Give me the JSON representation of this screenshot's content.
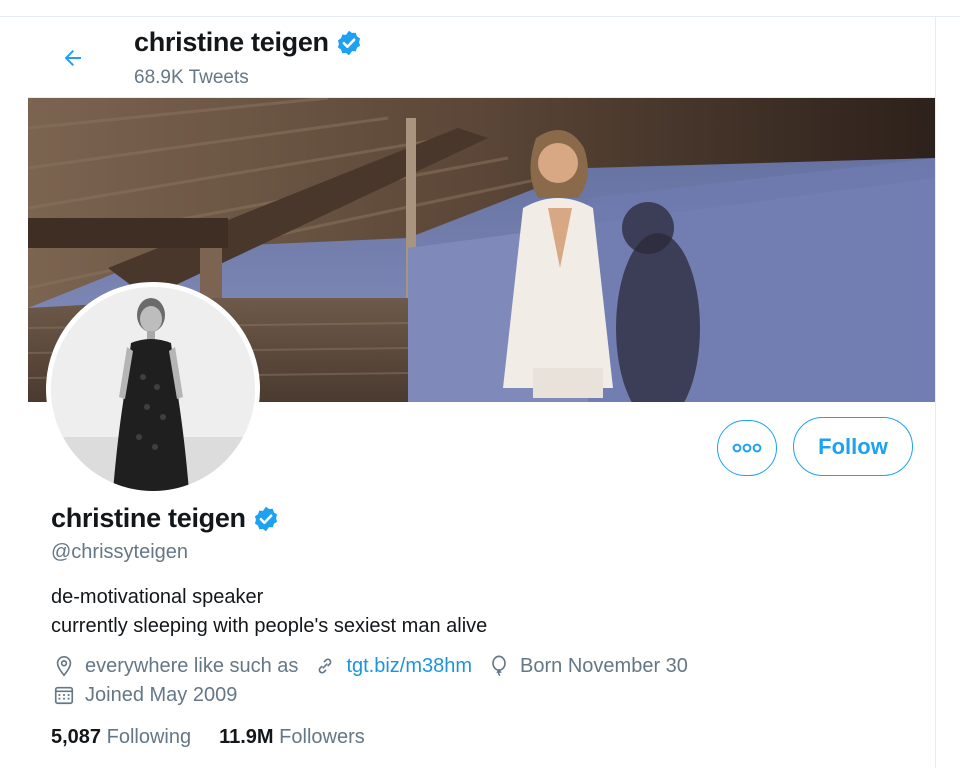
{
  "header": {
    "name": "christine teigen",
    "tweet_count": "68.9K Tweets"
  },
  "profile": {
    "name": "christine teigen",
    "handle": "@chrissyteigen",
    "bio_line1": "de-motivational speaker",
    "bio_line2": "currently sleeping with people's sexiest man alive",
    "location": "everywhere like such as",
    "website": "tgt.biz/m38hm",
    "birthday": "Born November 30",
    "joined": "Joined May 2009"
  },
  "actions": {
    "follow_label": "Follow",
    "more_icon": "more-horizontal-icon"
  },
  "stats": {
    "following_count": "5,087",
    "following_label": "Following",
    "followers_count": "11.9M",
    "followers_label": "Followers"
  },
  "icons": {
    "back": "arrow-left-icon",
    "verified": "verified-badge-icon",
    "location": "location-pin-icon",
    "link": "link-icon",
    "birthday": "balloon-icon",
    "calendar": "calendar-icon"
  },
  "colors": {
    "accent": "#1da1f2",
    "link": "#1b95e0",
    "secondary_text": "#657786",
    "primary_text": "#14171a"
  }
}
